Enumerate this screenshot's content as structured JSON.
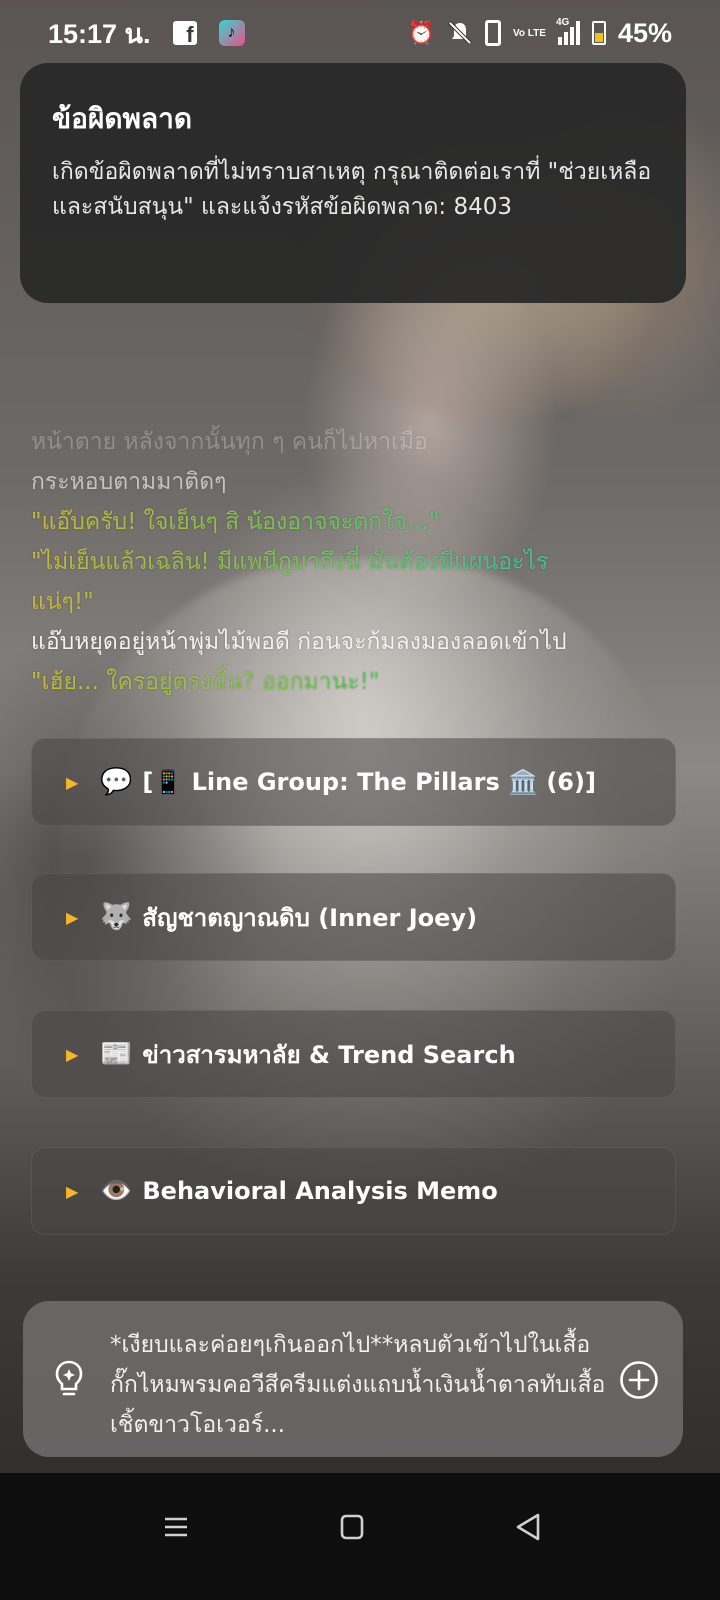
{
  "status_bar": {
    "time": "15:17 น.",
    "battery_percent": "45%",
    "network_type": "4G",
    "volte": "Vo LTE",
    "icons": [
      "facebook-icon",
      "tiktok-icon",
      "alarm-icon",
      "mute-icon",
      "phone-icon",
      "volte-icon",
      "signal-icon",
      "battery-icon"
    ]
  },
  "toast": {
    "title": "ข้อผิดพลาด",
    "message": "เกิดข้อผิดพลาดที่ไม่ทราบสาเหตุ กรุณาติดต่อเราที่ \"ช่วยเหลือและสนับสนุน\" และแจ้งรหัสข้อผิดพลาด: 8403"
  },
  "story": {
    "lines": [
      "หน้าตาย หลังจากนั้นทุก ๆ คนก็ไปหาเมื่อ",
      "กระหอบตามมาติดๆ",
      "\"แอ๊บครับ! ใจเย็นๆ สิ น้องอาจจะตกใจ...\"",
      "\"ไม่เย็นแล้วเฉลิน! มีแพนีกูมาถึงนี่ มันต้องมีแผนอะไร",
      "แน่ๆ!\"",
      "แอ๊บหยุดอยู่หน้าพุ่มไม้พอดี ก่อนจะก้มลงมองลอดเข้าไป",
      "\"เฮ้ย... ใครอยู่ตรงนั้น? ออกมานะ!\""
    ]
  },
  "sections": [
    {
      "emoji": "💬",
      "label": "[📱 Line Group: The Pillars 🏛️ (6)]"
    },
    {
      "emoji": "🐺",
      "label": "สัญชาตญาณดิบ (Inner Joey)"
    },
    {
      "emoji": "📰",
      "label": "ข่าวสารมหาลัย & Trend Search"
    },
    {
      "emoji": "👁️",
      "label": "Behavioral Analysis Memo"
    }
  ],
  "input": {
    "text": "*เงียบและค่อยๆเกินออกไป**หลบตัวเข้าไปในเสื้อกั๊กไหมพรมคอวีสีครีมแต่งแถบน้ำเงินน้ำตาลทับเสื้อเชิ้ตขาวโอเวอร์..."
  },
  "colors": {
    "accent_arrow": "#f2b72a",
    "dialogue_start": "#e8d645",
    "dialogue_end": "#2fd7e6"
  }
}
